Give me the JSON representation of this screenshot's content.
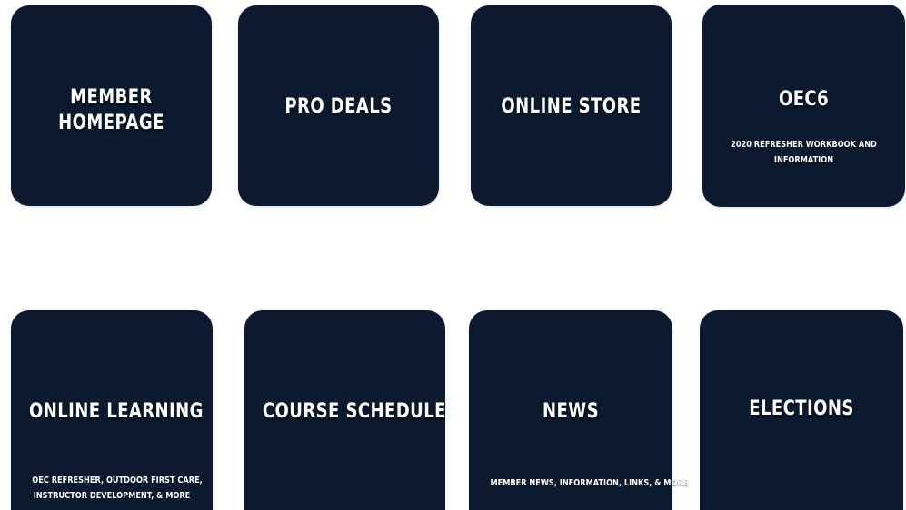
{
  "tiles": [
    {
      "title_lines": [
        "MEMBER",
        "HOMEPAGE"
      ],
      "subtitle_lines": []
    },
    {
      "title_lines": [
        "PRO DEALS"
      ],
      "subtitle_lines": []
    },
    {
      "title_lines": [
        "ONLINE STORE"
      ],
      "subtitle_lines": []
    },
    {
      "title_lines": [
        "OEC6"
      ],
      "subtitle_lines": [
        "2020 REFRESHER WORKBOOK AND",
        "INFORMATION"
      ]
    },
    {
      "title_lines": [
        "ONLINE LEARNING"
      ],
      "subtitle_lines": [
        "OEC REFRESHER, OUTDOOR FIRST CARE,",
        "INSTRUCTOR DEVELOPMENT, & MORE"
      ]
    },
    {
      "title_lines": [
        "COURSE SCHEDULE"
      ],
      "subtitle_lines": []
    },
    {
      "title_lines": [
        "NEWS"
      ],
      "subtitle_lines": [
        "MEMBER NEWS, INFORMATION, LINKS, & MORE"
      ]
    },
    {
      "title_lines": [
        "ELECTIONS"
      ],
      "subtitle_lines": []
    }
  ],
  "colors": {
    "tile_bg": "#0b1a2e",
    "text": "#ffffff",
    "page_bg": "#ffffff"
  }
}
